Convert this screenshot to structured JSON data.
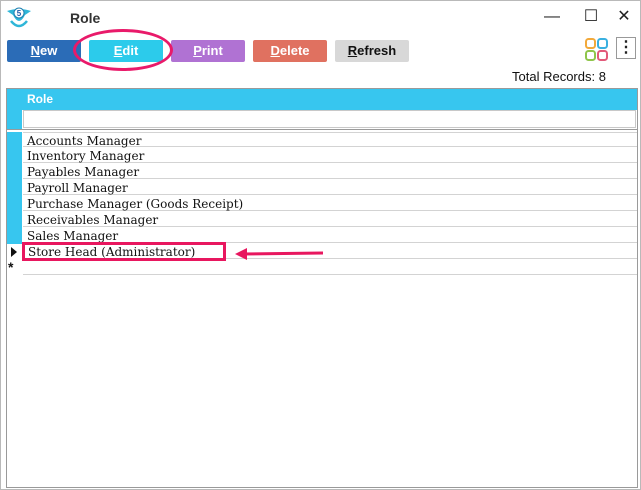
{
  "window": {
    "title": "Role",
    "controls": {
      "minimize": "—",
      "maximize": "☐",
      "close": "✕"
    }
  },
  "toolbar": {
    "new_label_u": "N",
    "new_label_rest": "ew",
    "edit_label_u": "E",
    "edit_label_rest": "dit",
    "print_label_u": "P",
    "print_label_rest": "rint",
    "delete_label_u": "D",
    "delete_label_rest": "elete",
    "refresh_label_u": "R",
    "refresh_label_rest": "efresh",
    "more_icon": "⋮"
  },
  "status": {
    "total_records": "Total Records: 8"
  },
  "grid": {
    "header": "Role",
    "rows": [
      "Accounts Manager",
      "Inventory Manager",
      "Payables Manager",
      "Payroll Manager",
      "Purchase Manager (Goods Receipt)",
      "Receivables Manager",
      "Sales Manager",
      "Store Head (Administrator)"
    ],
    "current_row": "Store Head (Administrator)",
    "new_row_marker": "*"
  },
  "colors": {
    "accent": "#37c6ef",
    "new": "#2b6cb7",
    "edit": "#2ccbeb",
    "print": "#b072d3",
    "delete": "#e07160",
    "refresh": "#d8d8d8",
    "annotation": "#e91a6a"
  },
  "icons": [
    "app-logo-icon",
    "apps-grid-icon",
    "more-vertical-icon",
    "row-pointer-icon"
  ]
}
